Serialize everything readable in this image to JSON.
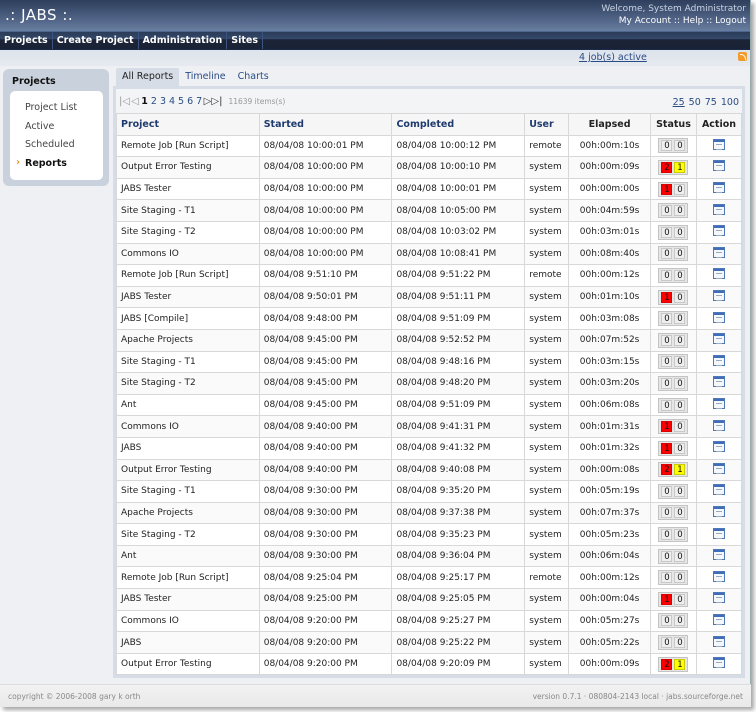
{
  "app": {
    "title": ".: JABS :.",
    "welcome": "Welcome, System Administrator",
    "account_links": [
      "My Account",
      "Help",
      "Logout"
    ],
    "account_separator": " :: "
  },
  "nav": {
    "items": [
      "Projects",
      "Create Project",
      "Administration",
      "Sites"
    ]
  },
  "subbar": {
    "jobs_active": "4 job(s) active",
    "rss_icon": "rss-feed-icon"
  },
  "sidebar": {
    "title": "Projects",
    "items": [
      {
        "label": "Project List",
        "active": false
      },
      {
        "label": "Active",
        "active": false
      },
      {
        "label": "Scheduled",
        "active": false
      },
      {
        "label": "Reports",
        "active": true
      }
    ],
    "active_marker": "›"
  },
  "tabs": [
    {
      "label": "All Reports",
      "active": true
    },
    {
      "label": "Timeline",
      "active": false
    },
    {
      "label": "Charts",
      "active": false
    }
  ],
  "pager": {
    "first_icon": "|◁",
    "prev_icon": "◁",
    "next_icon": "▷",
    "last_icon": "▷|",
    "pages": [
      "1",
      "2",
      "3",
      "4",
      "5",
      "6",
      "7"
    ],
    "current_page": "1",
    "item_count": "11639 items(s)",
    "page_sizes": [
      "25",
      "50",
      "75",
      "100"
    ],
    "current_page_size": "25"
  },
  "table": {
    "columns": [
      "Project",
      "Started",
      "Completed",
      "User",
      "Elapsed",
      "Status",
      "Action"
    ],
    "colors": {
      "error": "#ff0000",
      "warning": "#ffff00",
      "none": "#eeeeee"
    },
    "rows": [
      {
        "project": "Remote Job [Run Script]",
        "started": "08/04/08 10:00:01 PM",
        "completed": "08/04/08 10:00:12 PM",
        "user": "remote",
        "elapsed": "00h:00m:10s",
        "errors": "0",
        "warnings": "0"
      },
      {
        "project": "Output Error Testing",
        "started": "08/04/08 10:00:00 PM",
        "completed": "08/04/08 10:00:10 PM",
        "user": "system",
        "elapsed": "00h:00m:09s",
        "errors": "2",
        "warnings": "1"
      },
      {
        "project": "JABS Tester",
        "started": "08/04/08 10:00:00 PM",
        "completed": "08/04/08 10:00:01 PM",
        "user": "system",
        "elapsed": "00h:00m:00s",
        "errors": "1",
        "warnings": "0"
      },
      {
        "project": "Site Staging - T1",
        "started": "08/04/08 10:00:00 PM",
        "completed": "08/04/08 10:05:00 PM",
        "user": "system",
        "elapsed": "00h:04m:59s",
        "errors": "0",
        "warnings": "0"
      },
      {
        "project": "Site Staging - T2",
        "started": "08/04/08 10:00:00 PM",
        "completed": "08/04/08 10:03:02 PM",
        "user": "system",
        "elapsed": "00h:03m:01s",
        "errors": "0",
        "warnings": "0"
      },
      {
        "project": "Commons IO",
        "started": "08/04/08 10:00:00 PM",
        "completed": "08/04/08 10:08:41 PM",
        "user": "system",
        "elapsed": "00h:08m:40s",
        "errors": "0",
        "warnings": "0"
      },
      {
        "project": "Remote Job [Run Script]",
        "started": "08/04/08 9:51:10 PM",
        "completed": "08/04/08 9:51:22 PM",
        "user": "remote",
        "elapsed": "00h:00m:12s",
        "errors": "0",
        "warnings": "0"
      },
      {
        "project": "JABS Tester",
        "started": "08/04/08 9:50:01 PM",
        "completed": "08/04/08 9:51:11 PM",
        "user": "system",
        "elapsed": "00h:01m:10s",
        "errors": "1",
        "warnings": "0"
      },
      {
        "project": "JABS [Compile]",
        "started": "08/04/08 9:48:00 PM",
        "completed": "08/04/08 9:51:09 PM",
        "user": "system",
        "elapsed": "00h:03m:08s",
        "errors": "0",
        "warnings": "0"
      },
      {
        "project": "Apache Projects",
        "started": "08/04/08 9:45:00 PM",
        "completed": "08/04/08 9:52:52 PM",
        "user": "system",
        "elapsed": "00h:07m:52s",
        "errors": "0",
        "warnings": "0"
      },
      {
        "project": "Site Staging - T1",
        "started": "08/04/08 9:45:00 PM",
        "completed": "08/04/08 9:48:16 PM",
        "user": "system",
        "elapsed": "00h:03m:15s",
        "errors": "0",
        "warnings": "0"
      },
      {
        "project": "Site Staging - T2",
        "started": "08/04/08 9:45:00 PM",
        "completed": "08/04/08 9:48:20 PM",
        "user": "system",
        "elapsed": "00h:03m:20s",
        "errors": "0",
        "warnings": "0"
      },
      {
        "project": "Ant",
        "started": "08/04/08 9:45:00 PM",
        "completed": "08/04/08 9:51:09 PM",
        "user": "system",
        "elapsed": "00h:06m:08s",
        "errors": "0",
        "warnings": "0"
      },
      {
        "project": "Commons IO",
        "started": "08/04/08 9:40:00 PM",
        "completed": "08/04/08 9:41:31 PM",
        "user": "system",
        "elapsed": "00h:01m:31s",
        "errors": "1",
        "warnings": "0"
      },
      {
        "project": "JABS",
        "started": "08/04/08 9:40:00 PM",
        "completed": "08/04/08 9:41:32 PM",
        "user": "system",
        "elapsed": "00h:01m:32s",
        "errors": "1",
        "warnings": "0"
      },
      {
        "project": "Output Error Testing",
        "started": "08/04/08 9:40:00 PM",
        "completed": "08/04/08 9:40:08 PM",
        "user": "system",
        "elapsed": "00h:00m:08s",
        "errors": "2",
        "warnings": "1"
      },
      {
        "project": "Site Staging - T1",
        "started": "08/04/08 9:30:00 PM",
        "completed": "08/04/08 9:35:20 PM",
        "user": "system",
        "elapsed": "00h:05m:19s",
        "errors": "0",
        "warnings": "0"
      },
      {
        "project": "Apache Projects",
        "started": "08/04/08 9:30:00 PM",
        "completed": "08/04/08 9:37:38 PM",
        "user": "system",
        "elapsed": "00h:07m:37s",
        "errors": "0",
        "warnings": "0"
      },
      {
        "project": "Site Staging - T2",
        "started": "08/04/08 9:30:00 PM",
        "completed": "08/04/08 9:35:23 PM",
        "user": "system",
        "elapsed": "00h:05m:23s",
        "errors": "0",
        "warnings": "0"
      },
      {
        "project": "Ant",
        "started": "08/04/08 9:30:00 PM",
        "completed": "08/04/08 9:36:04 PM",
        "user": "system",
        "elapsed": "00h:06m:04s",
        "errors": "0",
        "warnings": "0"
      },
      {
        "project": "Remote Job [Run Script]",
        "started": "08/04/08 9:25:04 PM",
        "completed": "08/04/08 9:25:17 PM",
        "user": "remote",
        "elapsed": "00h:00m:12s",
        "errors": "0",
        "warnings": "0"
      },
      {
        "project": "JABS Tester",
        "started": "08/04/08 9:25:00 PM",
        "completed": "08/04/08 9:25:05 PM",
        "user": "system",
        "elapsed": "00h:00m:04s",
        "errors": "1",
        "warnings": "0"
      },
      {
        "project": "Commons IO",
        "started": "08/04/08 9:20:00 PM",
        "completed": "08/04/08 9:25:27 PM",
        "user": "system",
        "elapsed": "00h:05m:27s",
        "errors": "0",
        "warnings": "0"
      },
      {
        "project": "JABS",
        "started": "08/04/08 9:20:00 PM",
        "completed": "08/04/08 9:25:22 PM",
        "user": "system",
        "elapsed": "00h:05m:22s",
        "errors": "0",
        "warnings": "0"
      },
      {
        "project": "Output Error Testing",
        "started": "08/04/08 9:20:00 PM",
        "completed": "08/04/08 9:20:09 PM",
        "user": "system",
        "elapsed": "00h:00m:09s",
        "errors": "2",
        "warnings": "1"
      }
    ],
    "action_icon": "view-report-icon"
  },
  "footer": {
    "copyright": "copyright © 2006-2008 gary k orth",
    "version": "version 0.7.1 · 080804-2143 local · jabs.sourceforge.net"
  }
}
